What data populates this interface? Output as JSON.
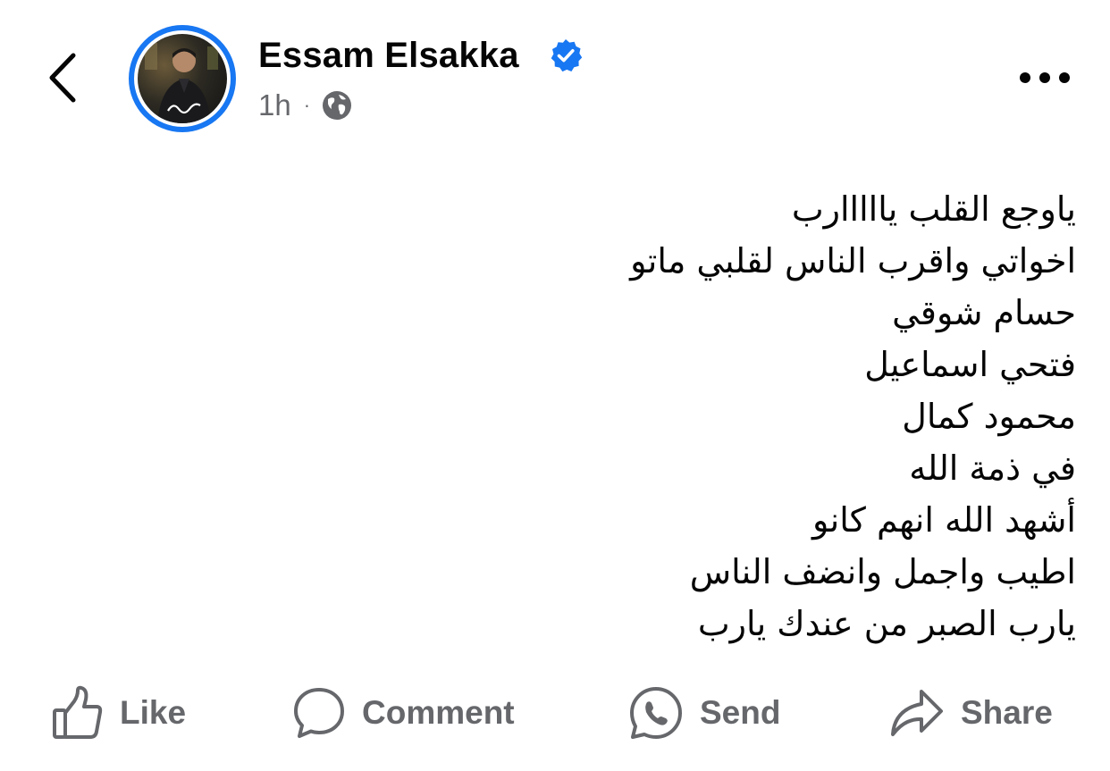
{
  "header": {
    "author_name": "Essam Elsakka",
    "verified": true,
    "timestamp": "1h",
    "separator": "·",
    "audience_icon": "globe-icon",
    "accent_color": "#1877f2"
  },
  "post": {
    "lines": [
      "ياوجع القلب يااااارب",
      "اخواتي واقرب الناس لقلبي ماتو",
      "حسام شوقي",
      "فتحي اسماعيل",
      "محمود كمال",
      "في ذمة الله",
      "أشهد الله انهم كانو",
      "اطيب واجمل وانضف الناس",
      "يارب الصبر من عندك يارب"
    ]
  },
  "actions": {
    "like": "Like",
    "comment": "Comment",
    "send": "Send",
    "share": "Share"
  }
}
